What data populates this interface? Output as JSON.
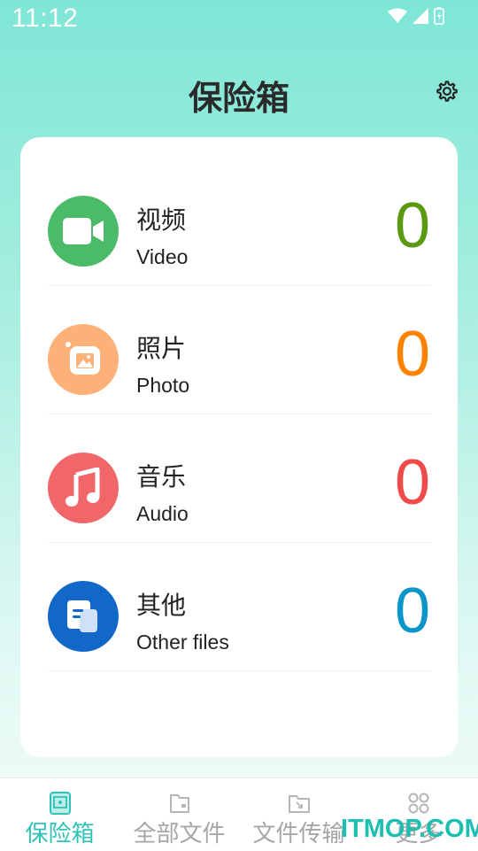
{
  "status_bar": {
    "time": "11:12"
  },
  "header": {
    "title": "保险箱",
    "settings_icon": "gear-icon"
  },
  "colors": {
    "video": "#4cbb69",
    "photo": "#fdb077",
    "audio": "#f16769",
    "other": "#1168c8",
    "video_count": "#5a9a12",
    "photo_count": "#fc8200",
    "audio_count": "#f04b4a",
    "other_count": "#0a96c8",
    "nav_active": "#2fc2b8"
  },
  "categories": [
    {
      "cn": "视频",
      "en": "Video",
      "count": "0",
      "icon": "video-camera-icon"
    },
    {
      "cn": "照片",
      "en": "Photo",
      "count": "0",
      "icon": "photo-icon"
    },
    {
      "cn": "音乐",
      "en": "Audio",
      "count": "0",
      "icon": "music-note-icon"
    },
    {
      "cn": "其他",
      "en": "Other files",
      "count": "0",
      "icon": "document-icon"
    }
  ],
  "bottom_nav": [
    {
      "label": "保险箱",
      "icon": "safe-icon",
      "active": true
    },
    {
      "label": "全部文件",
      "icon": "folder-icon",
      "active": false
    },
    {
      "label": "文件传输",
      "icon": "transfer-icon",
      "active": false
    },
    {
      "label": "更多",
      "icon": "grid-icon",
      "active": false
    }
  ],
  "watermark": "ITMOP.COM"
}
